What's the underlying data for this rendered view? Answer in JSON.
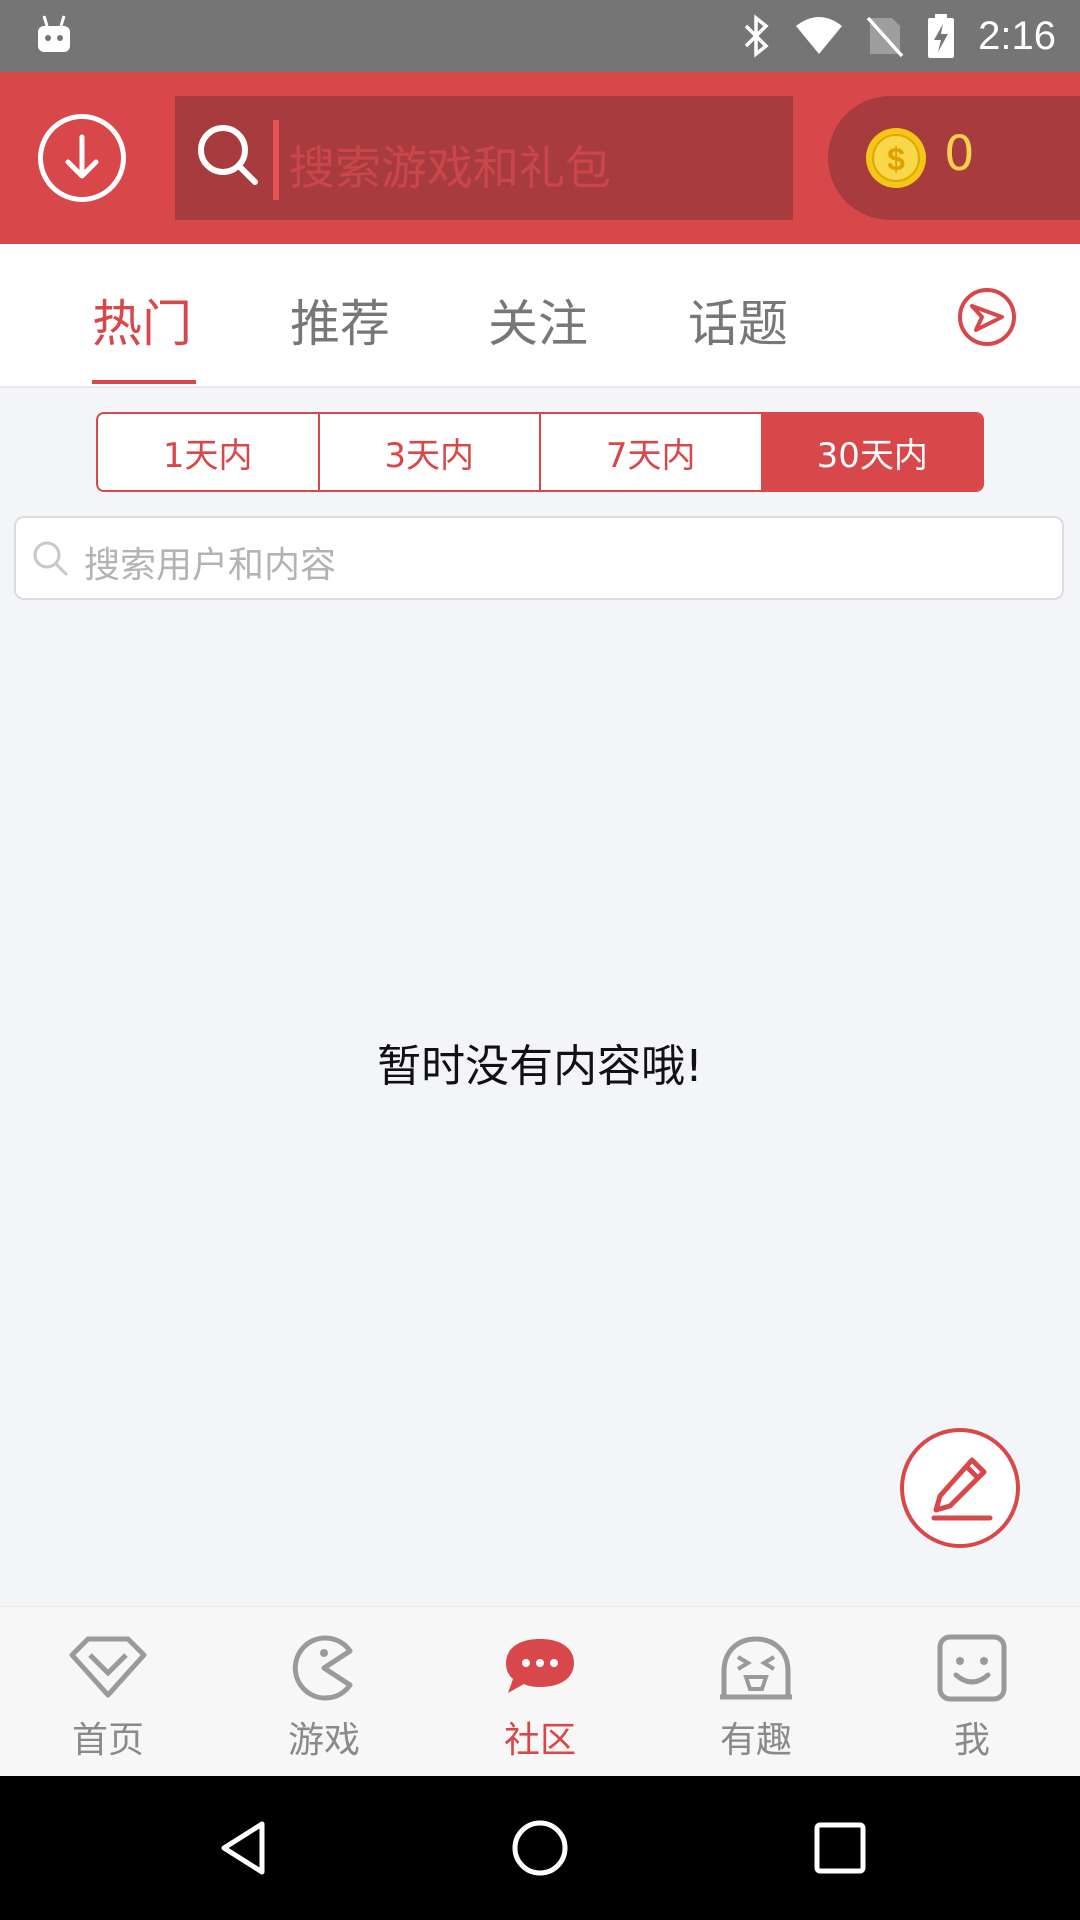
{
  "status_bar": {
    "time": "2:16"
  },
  "header": {
    "search_placeholder": "搜索游戏和礼包",
    "coin_count": "0"
  },
  "tabs": [
    {
      "label": "热门",
      "active": true
    },
    {
      "label": "推荐",
      "active": false
    },
    {
      "label": "关注",
      "active": false
    },
    {
      "label": "话题",
      "active": false
    }
  ],
  "time_filters": [
    {
      "label": "1天内",
      "selected": false
    },
    {
      "label": "3天内",
      "selected": false
    },
    {
      "label": "7天内",
      "selected": false
    },
    {
      "label": "30天内",
      "selected": true
    }
  ],
  "user_search_placeholder": "搜索用户和内容",
  "empty_message": "暂时没有内容哦!",
  "bottom_nav": [
    {
      "label": "首页",
      "icon": "diamond-icon",
      "active": false
    },
    {
      "label": "游戏",
      "icon": "pacman-icon",
      "active": false
    },
    {
      "label": "社区",
      "icon": "chat-bubble-icon",
      "active": true
    },
    {
      "label": "有趣",
      "icon": "funny-face-icon",
      "active": false
    },
    {
      "label": "我",
      "icon": "smiley-face-icon",
      "active": false
    }
  ],
  "colors": {
    "accent": "#d84749",
    "header_dark": "#a83b3d",
    "coin": "#f7d24b"
  }
}
